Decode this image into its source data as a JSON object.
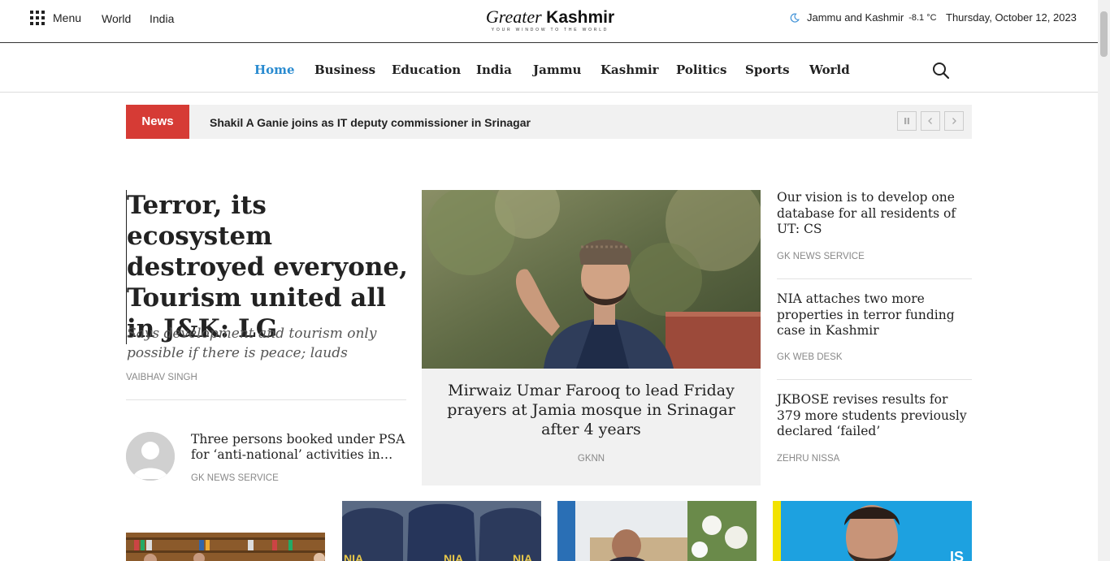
{
  "topbar": {
    "menu_label": "Menu",
    "links": [
      "World",
      "India"
    ],
    "logo_main_1": "Greater",
    "logo_main_2": "Kashmir",
    "logo_tagline": "YOUR WINDOW TO THE WORLD",
    "weather_location": "Jammu and Kashmir",
    "weather_temp": "-8.1 °C",
    "date": "Thursday, October 12, 2023"
  },
  "nav": {
    "items": [
      "Home",
      "Business",
      "Education",
      "India",
      "Jammu",
      "Kashmir",
      "Politics",
      "Sports",
      "World"
    ],
    "active": "Home"
  },
  "ticker": {
    "label": "News",
    "headline": "Shakil A Ganie joins as IT deputy commissioner in Srinagar"
  },
  "lead": {
    "title": "Terror, its ecosystem destroyed everyone, Tourism united all in J&K: LG",
    "subtitle": "Says development and tourism only possible if there is peace; lauds security…",
    "author": "VAIBHAV SINGH"
  },
  "small_story": {
    "title": "Three persons booked under PSA for ‘anti-national’ activities in…",
    "author": "GK NEWS SERVICE"
  },
  "feature": {
    "title": "Mirwaiz Umar Farooq to lead Friday prayers at Jamia mosque in Srinagar after 4 years",
    "author": "GKNN"
  },
  "right_stories": [
    {
      "title": "Our vision is to develop one database for all residents of UT: CS",
      "author": "GK NEWS SERVICE"
    },
    {
      "title": "NIA attaches two more properties in terror funding case in Kashmir",
      "author": "GK WEB DESK"
    },
    {
      "title": "JKBOSE revises results for 379 more students previously declared ‘failed’",
      "author": "ZEHRU NISSA"
    }
  ],
  "bottom_cards": {
    "card2_jacket_text": "NIA",
    "card4_text": "IS"
  },
  "colors": {
    "accent": "#2a8bd0",
    "ticker_red": "#d63b35",
    "ticker_bg": "#f1f1f1"
  }
}
